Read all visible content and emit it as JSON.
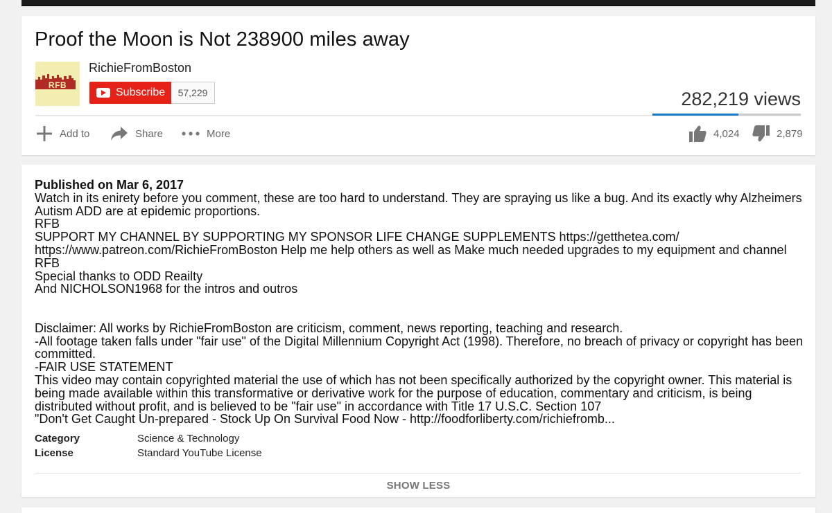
{
  "video": {
    "title": "Proof the Moon is Not 238900 miles away",
    "views": "282,219 views",
    "likes": "4,024",
    "dislikes": "2,879",
    "like_ratio": 0.58
  },
  "channel": {
    "name": "RichieFromBoston",
    "avatar_text": "RFB",
    "subscribe_label": "Subscribe",
    "subscriber_count": "57,229"
  },
  "actions": {
    "add_to": "Add to",
    "share": "Share",
    "more": "More"
  },
  "description": {
    "published": "Published on Mar 6, 2017",
    "lines": [
      "Watch in its enirety before you comment, these are too hard to understand. They are spraying us like a bug. And its exactly why Alzheimers Autism ADD are at epidemic proportions.",
      "RFB",
      "SUPPORT MY CHANNEL BY SUPPORTING MY SPONSOR LIFE CHANGE SUPPLEMENTS https://getthetea.com/",
      "https://www.patreon.com/RichieFromBoston Help me help others as well as Make much needed upgrades to my equipment and channel",
      "RFB",
      "Special thanks to ODD Reailty",
      "And NICHOLSON1968 for the intros and outros"
    ],
    "disclaimer_lines": [
      "Disclaimer: All works by RichieFromBoston are criticism, comment, news reporting, teaching and research.",
      "-All footage taken falls under \"fair use\" of the Digital Millennium Copyright Act (1998). Therefore, no breach of privacy or copyright has been committed.",
      "-FAIR USE STATEMENT",
      "This video may contain copyrighted material the use of which has not been specifically authorized by the copyright owner. This material is being made available within this transformative or derivative work for the purpose of education, commentary and criticism, is being distributed without profit, and is believed to be \"fair use\" in accordance with Title 17 U.S.C. Section 107",
      "\"Don't Get Caught Un-prepared - Stock Up On Survival Food Now - http://foodforliberty.com/richiefromb..."
    ]
  },
  "meta": {
    "category_label": "Category",
    "category_value": "Science & Technology",
    "license_label": "License",
    "license_value": "Standard YouTube License"
  },
  "show_less": "SHOW LESS",
  "colors": {
    "subscribe": "#e62117",
    "like_bar": "#167ac6",
    "background": "#f1f1f1"
  }
}
